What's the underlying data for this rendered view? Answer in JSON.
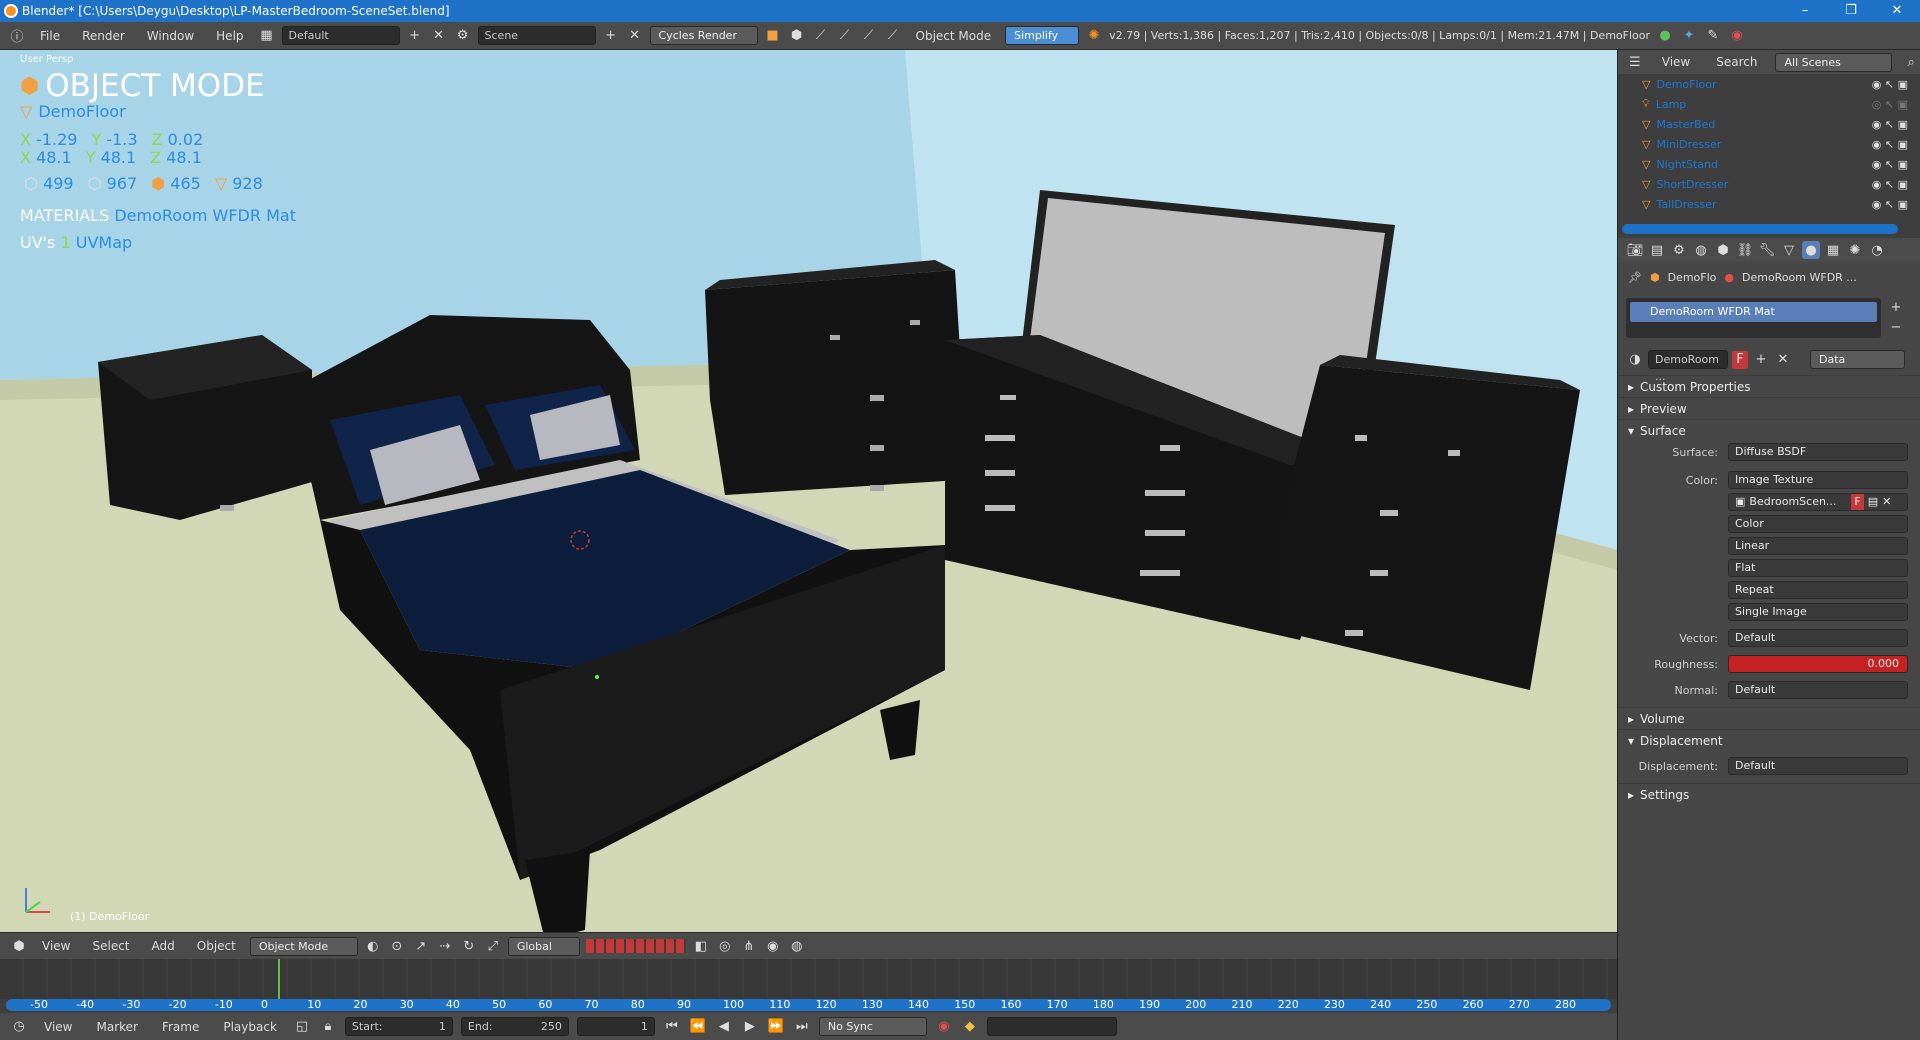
{
  "window": {
    "title": "Blender* [C:\\Users\\Deygu\\Desktop\\LP-MasterBedroom-SceneSet.blend]",
    "min": "–",
    "max": "❐",
    "close": "✕"
  },
  "infobar": {
    "menus": [
      "File",
      "Render",
      "Window",
      "Help"
    ],
    "layout": "Default",
    "scene": "Scene",
    "engine": "Cycles Render",
    "mode_text": "Object Mode",
    "simplify": "Simplify",
    "stats": "v2.79 | Verts:1,386 | Faces:1,207 | Tris:2,410 | Objects:0/8 | Lamps:0/1 | Mem:21.47M | DemoFloor"
  },
  "viewport": {
    "view_label": "User Persp",
    "mode_title": "OBJECT MODE",
    "object_name": "DemoFloor",
    "loc": {
      "x": "-1.29",
      "y": "-1.3",
      "z": "0.02"
    },
    "scale": {
      "x": "48.1",
      "y": "48.1",
      "z": "48.1"
    },
    "counts": [
      "499",
      "967",
      "465",
      "928"
    ],
    "materials_label": "MATERIALS",
    "materials_value": "DemoRoom WFDR Mat",
    "uv_label": "UV's",
    "uv_count": "1",
    "uv_value": "UVMap",
    "bottom_label": "(1) DemoFloor"
  },
  "view_header": {
    "menus": [
      "View",
      "Select",
      "Add",
      "Object"
    ],
    "mode": "Object Mode",
    "orientation": "Global"
  },
  "timeline": {
    "ticks": [
      "-50",
      "-40",
      "-30",
      "-20",
      "-10",
      "0",
      "10",
      "20",
      "30",
      "40",
      "50",
      "60",
      "70",
      "80",
      "90",
      "100",
      "110",
      "120",
      "130",
      "140",
      "150",
      "160",
      "170",
      "180",
      "190",
      "200",
      "210",
      "220",
      "230",
      "240",
      "250",
      "260",
      "270",
      "280"
    ],
    "current_frame": 0
  },
  "timeline_header": {
    "menus": [
      "View",
      "Marker",
      "Frame",
      "Playback"
    ],
    "start_label": "Start:",
    "start_value": "1",
    "end_label": "End:",
    "end_value": "250",
    "current": "1",
    "sync": "No Sync"
  },
  "outliner": {
    "view": "View",
    "search": "Search",
    "scenes": "All Scenes",
    "items": [
      "DemoFloor",
      "Lamp",
      "MasterBed",
      "MiniDresser",
      "NightStand",
      "ShortDresser",
      "TallDresser"
    ]
  },
  "properties": {
    "breadcrumb_obj": "DemoFlo",
    "breadcrumb_mat": "DemoRoom WFDR ...",
    "slot_name": "DemoRoom WFDR Mat",
    "mat_field": "DemoRoom ...",
    "mat_f": "F",
    "mat_type": "Data",
    "panels": {
      "custom": "Custom Properties",
      "preview": "Preview",
      "surface": "Surface",
      "volume": "Volume",
      "displacement": "Displacement",
      "settings": "Settings"
    },
    "surface_label": "Surface:",
    "surface_value": "Diffuse BSDF",
    "color_label": "Color:",
    "color_value": "Image Texture",
    "image_name": "BedroomScen...",
    "image_f": "F",
    "tex_options": [
      "Color",
      "Linear",
      "Flat",
      "Repeat",
      "Single Image"
    ],
    "vector_label": "Vector:",
    "vector_value": "Default",
    "roughness_label": "Roughness:",
    "roughness_value": "0.000",
    "normal_label": "Normal:",
    "normal_value": "Default",
    "disp_label": "Displacement:",
    "disp_value": "Default"
  }
}
